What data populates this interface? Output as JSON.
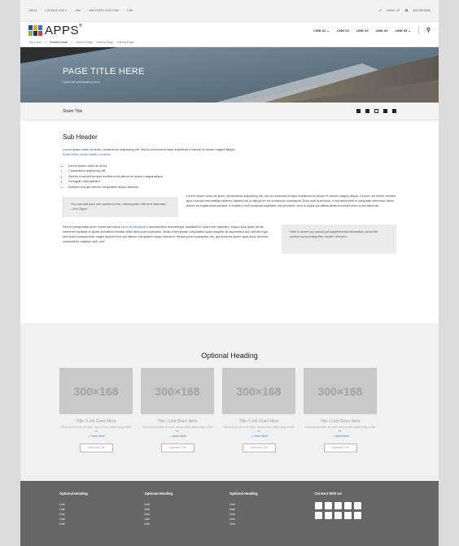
{
  "utility": {
    "left_links": [
      "LINK ▾",
      "LONGER LINK ▾",
      "LINK",
      "ANOTHER LONG LINK",
      "LINK"
    ],
    "email": "EMAIL US",
    "phone": "800.555.5555"
  },
  "header": {
    "logo_text": "APPS",
    "logo_mark": "®",
    "logo_colors": [
      "#1a4e8c",
      "#e7a81b",
      "#2a77c9",
      "#7ab648",
      "#0f3765",
      "#c7472b"
    ],
    "nav_links": [
      "LINK 01 ⌄",
      "LINK 02",
      "LINK 03",
      "LINK 04",
      "LINK 05 ⌄"
    ],
    "search_icon": "search-icon"
  },
  "breadcrumb": [
    "Top Level",
    ">",
    "Current Level",
    ">",
    "Interior Page",
    "Interior Page",
    "Interior Page"
  ],
  "hero": {
    "title": "PAGE TITLE HERE",
    "subtitle": "Optional subheading here"
  },
  "share": {
    "label": "Share This",
    "icons": [
      "calendar-icon",
      "facebook-icon",
      "email-icon",
      "print-icon",
      "share-icon"
    ]
  },
  "content": {
    "subheader": "Sub Header",
    "intro": "Lorem ipsum dolor sit amet, consectetur adipiscing elit, sed do eiusmod tempor incididunt ut labore et dolore magna aliqua...",
    "read_more": "Read More (show hidden content)",
    "bullets": [
      "Lorem ipsum dolor sit amet",
      "Consectetur adipiscing elit",
      "Sed do eiusmod tempor incididunt ut labore et dolore magna aliqua",
      "Eu fugiat nulla pariatur",
      "Dolores eos qui ratione voluptatem sequi nesciunt"
    ],
    "quote": "\"You can add your own quotes to this <blockquote> element manually.\"",
    "quote_author": "—Eric Bayer",
    "right_para": "Lorem ipsum dolor sit amet, consectetur adipiscing elit, sed do eiusmod tempor incididunt ut labore et dolore magna aliqua. Ut enim ad minim veniam, quis nostrud exercitation ullamco laboris nisi ut aliquip ex ea commodo consequat. Duis aute irure dolor in reprehenderit in voluptate velit esse cillum dolore eu fugiat nulla pariatur. Excepteur sint occaecat cupidatat non proident, sunt in culpa qui officia deserunt mollit anim id est laborum.",
    "para2_start": "Sed ut perspiciatis unde omnis iste natus",
    "para2_link": "error sit voluptatem",
    "para2_rest": "accusantium doloremque laudantium, totam rem aperiam, eaque ipsa quae ab illo inventore veritatis et quasi architecto beatae vitae dicta sunt explicabo. Nemo enim ipsam voluptatem quia voluptas sit aspernatur aut odit aut fugit, sed quia consequuntur magni dolores eos qui ratione voluptatem sequi nesciunt. Neque porro quisquam est, qui dolorem ipsum quia dolor sit amet, consectetur, adipisci velit, sed",
    "aside": "Here is where you would put supplemental information about the content surrounding this <aside> element"
  },
  "optional": {
    "heading": "Optional Heading",
    "cards": [
      {
        "image": "300×168",
        "title": "Title / Link Goes Here",
        "desc": "lorem ipsum dolor sit amet, consec tetur adipis icing a erat elit",
        "more": "— Learn More",
        "cta": "Optional CTA"
      },
      {
        "image": "300×168",
        "title": "Title / Link Goes Here",
        "desc": "lorem ipsum dolor sit amet, consec tetur adipis icing a erat elit",
        "more": "— Learn More",
        "cta": "Optional CTA"
      },
      {
        "image": "300×168",
        "title": "Title / Link Goes Here",
        "desc": "lorem ipsum dolor sit amet, consec tetur adipis icing a erat elit",
        "more": "— Learn More",
        "cta": "Optional CTA"
      },
      {
        "image": "300×168",
        "title": "Title / Link Goes Here",
        "desc": "lorem ipsum dolor sit amet, consec tetur adipis icing a erat elit",
        "more": "— Learn More",
        "cta": "Optional CTA"
      }
    ]
  },
  "footer": {
    "columns": [
      {
        "heading": "Optional Heading",
        "links": [
          "Link",
          "Link",
          "Link",
          "Link",
          "Link"
        ]
      },
      {
        "heading": "Optional Heading",
        "links": [
          "Link",
          "Link",
          "Link",
          "Link",
          "Link"
        ]
      },
      {
        "heading": "Optional Heading",
        "links": [
          "Link",
          "Link",
          "Link",
          "Link",
          "Link"
        ]
      }
    ],
    "connect_heading": "Connect With Us",
    "social_icons": [
      "facebook-icon",
      "twitter-icon",
      "youtube-icon",
      "linkedin-icon",
      "rss-icon",
      "google-plus-icon",
      "skype-icon",
      "flickr-icon",
      "instagram-icon",
      "pinterest-icon"
    ]
  }
}
